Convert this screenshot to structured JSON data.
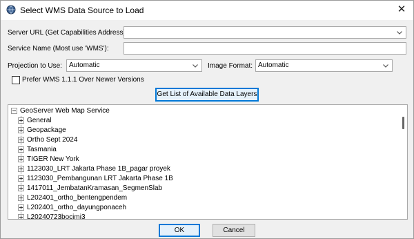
{
  "window": {
    "title": "Select WMS Data Source to Load",
    "close_glyph": "✕"
  },
  "form": {
    "server_url_label": "Server URL (Get Capabilities Address):",
    "server_url_value": "",
    "service_name_label": "Service Name (Most use 'WMS'):",
    "service_name_value": "",
    "projection_label": "Projection to Use:",
    "projection_value": "Automatic",
    "image_format_label": "Image Format:",
    "image_format_value": "Automatic",
    "prefer_wms_label": "Prefer WMS 1.1.1 Over Newer Versions",
    "prefer_wms_checked": false,
    "get_layers_label": "Get List of Available Data Layers"
  },
  "tree": {
    "root": "GeoServer Web Map Service",
    "items": [
      "General",
      "Geopackage",
      "Ortho Sept 2024",
      "Tasmania",
      "TIGER New York",
      "1123030_LRT Jakarta Phase 1B_pagar proyek",
      "1123030_Pembangunan LRT Jakarta Phase 1B",
      "1417011_JembatanKramasan_SegmenSlab",
      "L202401_ortho_bentengpendem",
      "L202401_ortho_dayungponaceh",
      "L20240723bocimi3"
    ]
  },
  "footer": {
    "ok_label": "OK",
    "cancel_label": "Cancel"
  },
  "icons": {
    "app": "globe-icon",
    "close": "close-icon",
    "dropdown": "chevron-down-icon",
    "expand": "plus-box-icon",
    "collapse": "minus-box-icon"
  },
  "colors": {
    "focus_border": "#0078d7",
    "button_face": "#e1e1e1"
  }
}
